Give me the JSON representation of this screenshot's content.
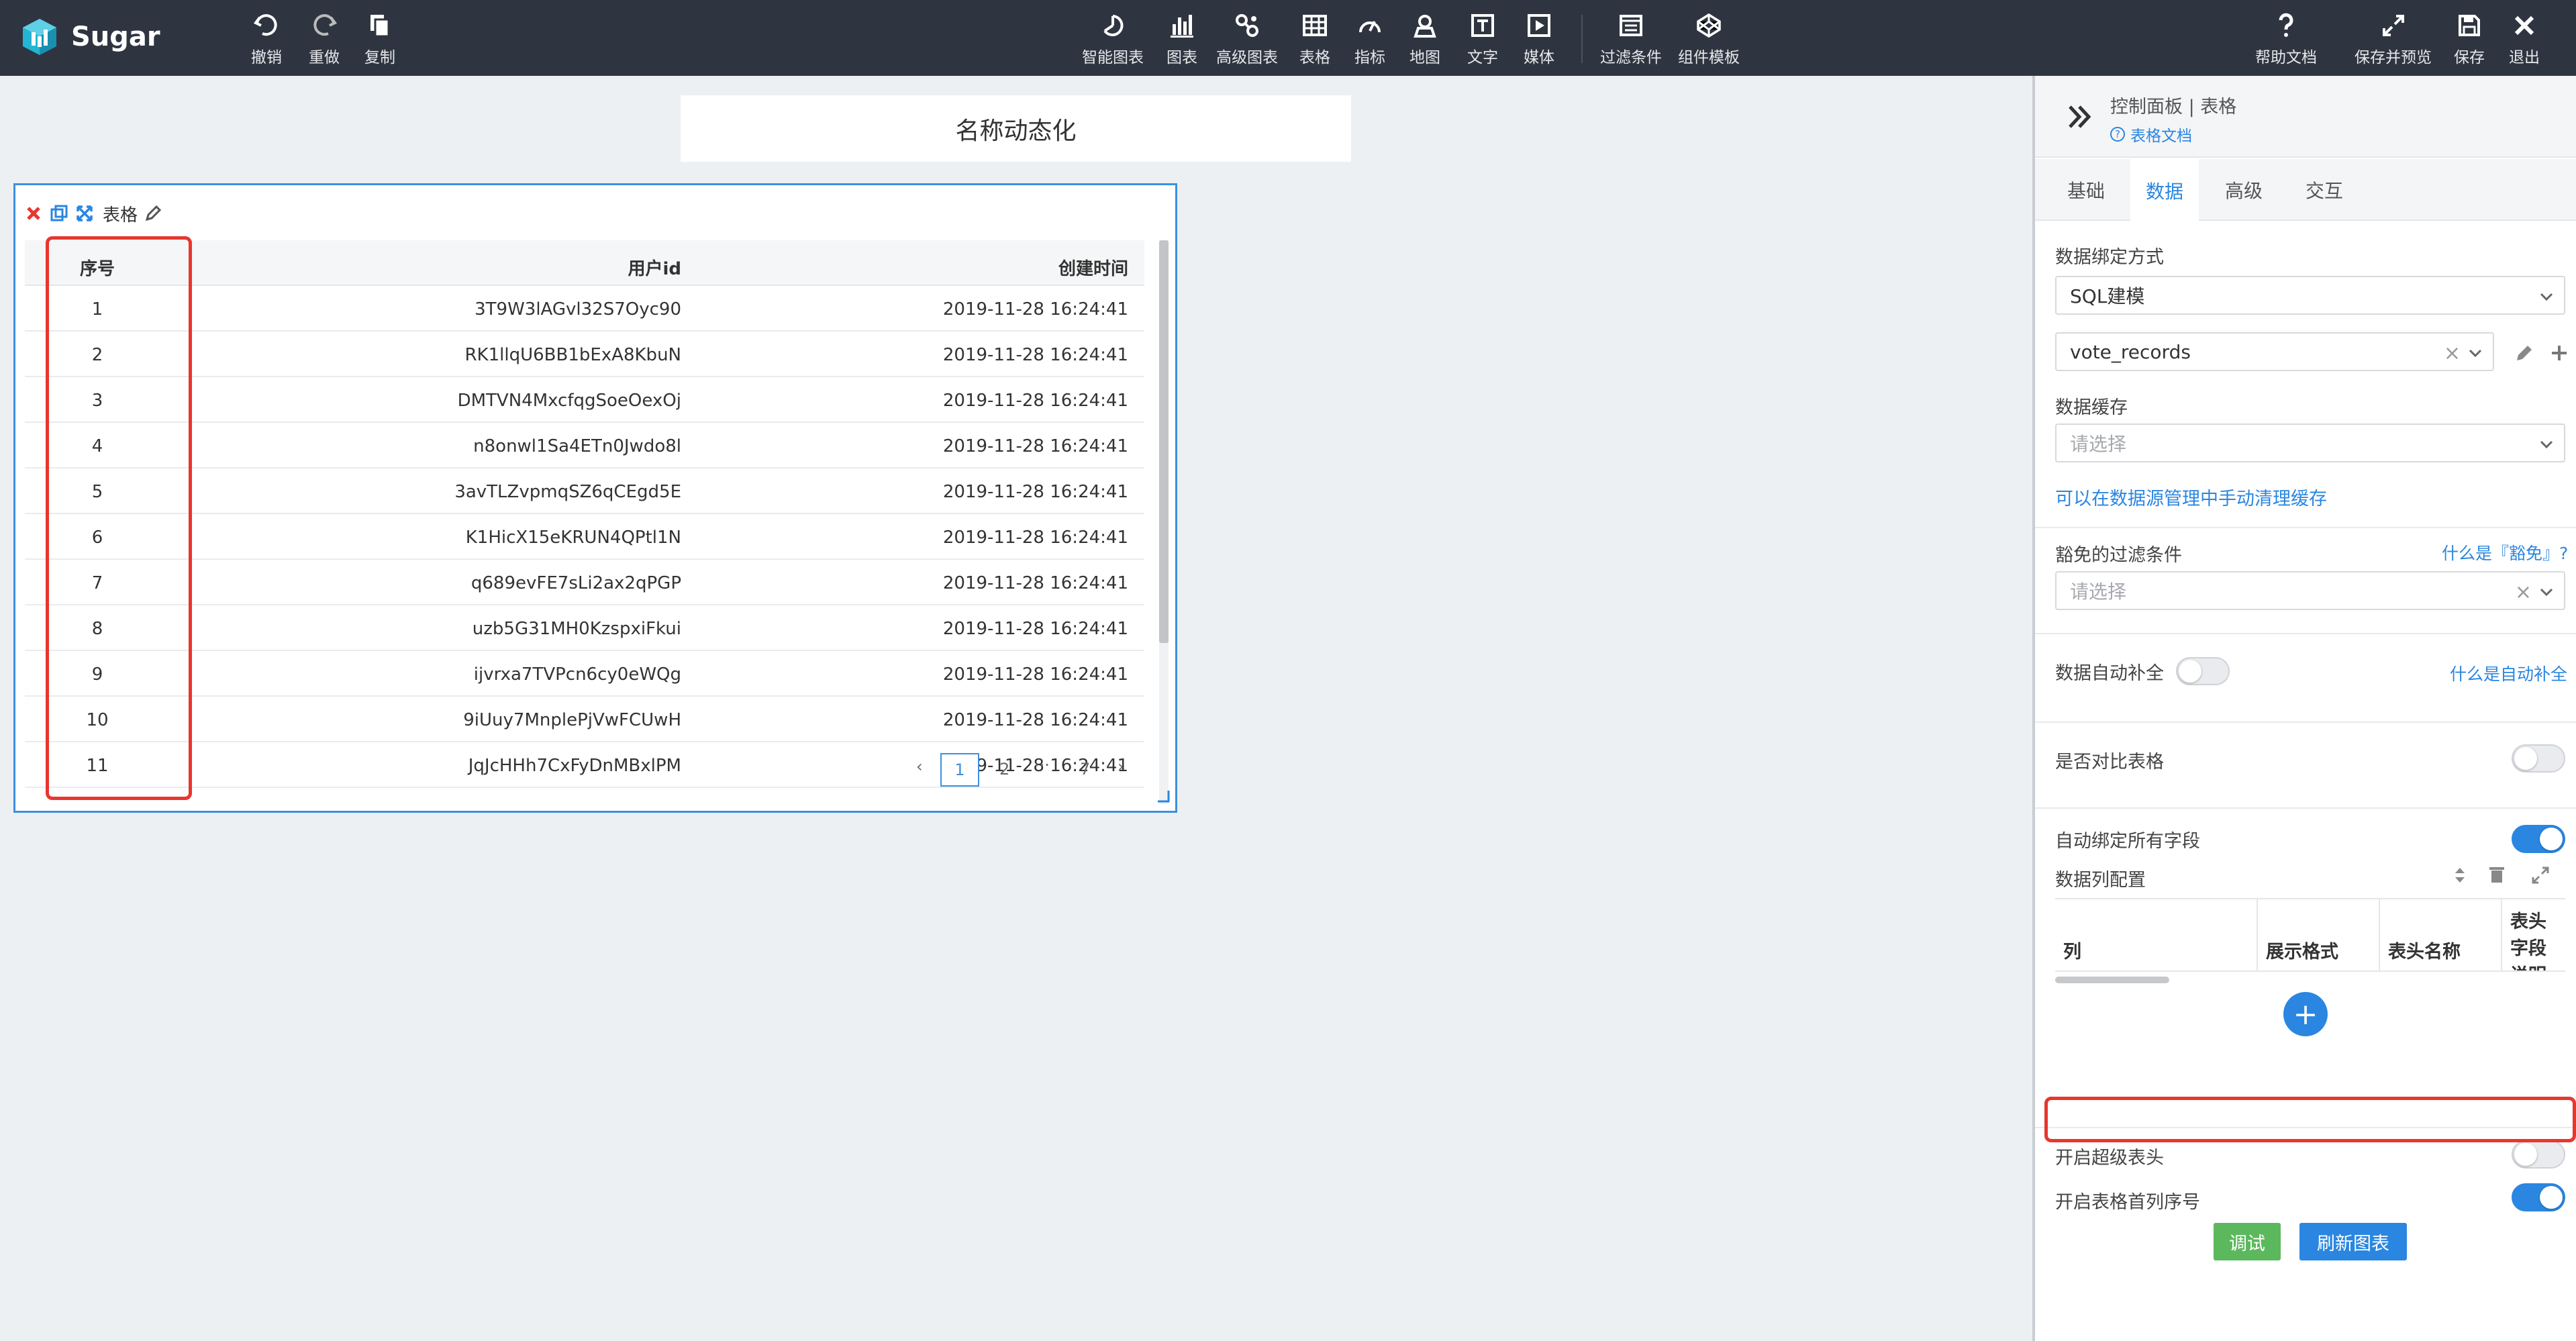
{
  "app": {
    "name": "Sugar",
    "brand_color": "#2f3540",
    "accent_color": "#2a86e0"
  },
  "toolbar": {
    "undo": "撤销",
    "redo": "重做",
    "copy": "复制",
    "smart_chart": "智能图表",
    "chart": "图表",
    "advanced_chart": "高级图表",
    "table": "表格",
    "indicator": "指标",
    "map": "地图",
    "text": "文字",
    "media": "媒体",
    "filter": "过滤条件",
    "component_template": "组件模板",
    "help": "帮助文档",
    "save_preview": "保存并预览",
    "save": "保存",
    "exit": "退出"
  },
  "canvas": {
    "title": "名称动态化",
    "widget": {
      "title": "表格",
      "columns": [
        "序号",
        "用户id",
        "创建时间"
      ],
      "rows": [
        [
          "1",
          "3T9W3lAGvl32S7Oyc90",
          "2019-11-28 16:24:41"
        ],
        [
          "2",
          "RK1llqU6BB1bExA8KbuN",
          "2019-11-28 16:24:41"
        ],
        [
          "3",
          "DMTVN4MxcfqgSoeOexOj",
          "2019-11-28 16:24:41"
        ],
        [
          "4",
          "n8onwl1Sa4ETn0Jwdo8l",
          "2019-11-28 16:24:41"
        ],
        [
          "5",
          "3avTLZvpmqSZ6qCEgd5E",
          "2019-11-28 16:24:41"
        ],
        [
          "6",
          "K1HicX15eKRUN4QPtl1N",
          "2019-11-28 16:24:41"
        ],
        [
          "7",
          "q689evFE7sLi2ax2qPGP",
          "2019-11-28 16:24:41"
        ],
        [
          "8",
          "uzb5G31MH0KzspxiFkui",
          "2019-11-28 16:24:41"
        ],
        [
          "9",
          "ijvrxa7TVPcn6cy0eWQg",
          "2019-11-28 16:24:41"
        ],
        [
          "10",
          "9iUuy7MnplePjVwFCUwH",
          "2019-11-28 16:24:41"
        ],
        [
          "11",
          "JqJcHHh7CxFyDnMBxlPM",
          "2019-11-28 16:24:41"
        ]
      ],
      "pager": {
        "prev": "‹",
        "current": "1",
        "page2": "2",
        "ellipsis": "···",
        "last": "7",
        "next": "›"
      }
    }
  },
  "panel": {
    "breadcrumb": "控制面板 | 表格",
    "doc_link": "表格文档",
    "tabs": [
      "基础",
      "数据",
      "高级",
      "交互"
    ],
    "active_tab": "数据",
    "binding_label": "数据绑定方式",
    "binding_value": "SQL建模",
    "model_value": "vote_records",
    "cache_label": "数据缓存",
    "cache_placeholder": "请选择",
    "cache_link": "可以在数据源管理中手动清理缓存",
    "exempt_label": "豁免的过滤条件",
    "exempt_help": "什么是『豁免』?",
    "exempt_placeholder": "请选择",
    "autofill_label": "数据自动补全",
    "autofill_help": "什么是自动补全",
    "compare_label": "是否对比表格",
    "autobind_label": "自动绑定所有字段",
    "colcfg_label": "数据列配置",
    "colcfg_headers": [
      "列",
      "展示格式",
      "表头名称",
      "表头字段说明"
    ],
    "super_header_label": "开启超级表头",
    "first_col_index_label": "开启表格首列序号",
    "debug_button": "调试",
    "refresh_button": "刷新图表",
    "toggles": {
      "autofill": false,
      "compare": false,
      "autobind": true,
      "super_header": false,
      "first_col_index": true
    }
  }
}
